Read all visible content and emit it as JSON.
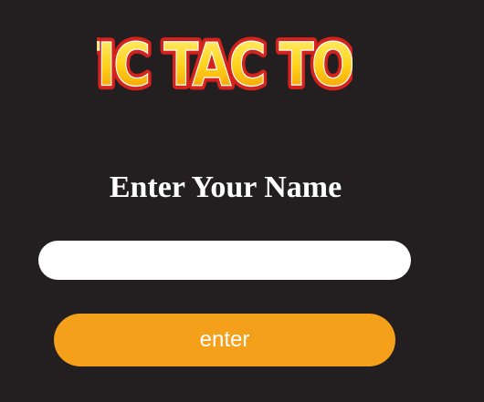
{
  "logo": {
    "text": "TIC TAC TOE",
    "colors": {
      "fill_top": "#fff27a",
      "fill_bottom": "#f5a000",
      "outline": "#d4221c",
      "highlight": "#ffffff"
    }
  },
  "form": {
    "heading": "Enter Your Name",
    "name_input_value": "",
    "enter_label": "enter"
  },
  "colors": {
    "background": "#231f20",
    "button": "#f5a01b",
    "input": "#ffffff"
  }
}
